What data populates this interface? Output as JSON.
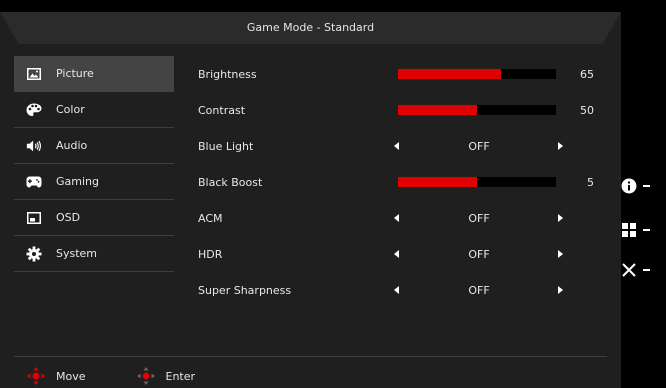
{
  "header": {
    "title": "Game Mode - Standard"
  },
  "sidebar": {
    "items": [
      {
        "label": "Picture",
        "icon": "picture-icon",
        "active": true
      },
      {
        "label": "Color",
        "icon": "palette-icon",
        "active": false
      },
      {
        "label": "Audio",
        "icon": "speaker-icon",
        "active": false
      },
      {
        "label": "Gaming",
        "icon": "gamepad-icon",
        "active": false
      },
      {
        "label": "OSD",
        "icon": "osd-icon",
        "active": false
      },
      {
        "label": "System",
        "icon": "gear-icon",
        "active": false
      }
    ]
  },
  "settings": {
    "brightness": {
      "label": "Brightness",
      "value": "65",
      "level": 65
    },
    "contrast": {
      "label": "Contrast",
      "value": "50",
      "level": 50
    },
    "blue_light": {
      "label": "Blue Light",
      "value": "OFF"
    },
    "black_boost": {
      "label": "Black Boost",
      "value": "5",
      "level": 50
    },
    "acm": {
      "label": "ACM",
      "value": "OFF"
    },
    "hdr": {
      "label": "HDR",
      "value": "OFF"
    },
    "super_sharpness": {
      "label": "Super Sharpness",
      "value": "OFF"
    }
  },
  "footer": {
    "move_label": "Move",
    "enter_label": "Enter"
  },
  "hotkeys": [
    {
      "icon": "info-icon"
    },
    {
      "icon": "grid-icon"
    },
    {
      "icon": "close-icon"
    }
  ],
  "colors": {
    "accent": "#e10000",
    "panel": "#1f1f1f",
    "active_item": "#444444"
  }
}
